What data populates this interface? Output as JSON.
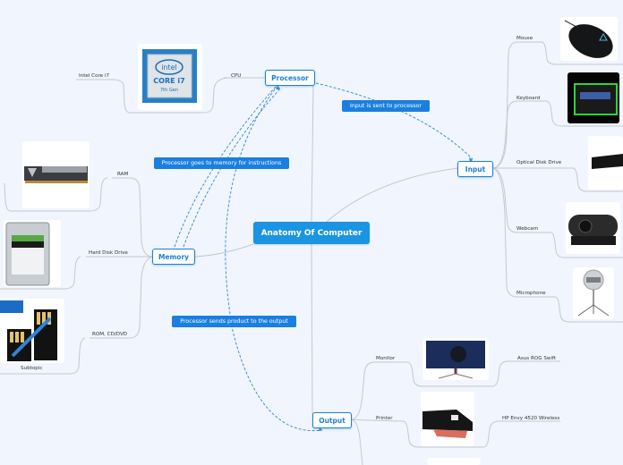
{
  "central": {
    "label": "Anatomy Of Computer"
  },
  "branches": {
    "processor": {
      "label": "Processor",
      "subtopics": [
        {
          "label": "CPU",
          "children": [
            {
              "label": "Intel Core i7"
            }
          ]
        }
      ],
      "images": [
        "intel-core-i7-7th-gen"
      ]
    },
    "memory": {
      "label": "Memory",
      "subtopics": [
        {
          "label": "RAM"
        },
        {
          "label": "Hard Disk Drive"
        },
        {
          "label": "ROM, CD/DVD",
          "children": [
            {
              "label": "Subtopic"
            }
          ]
        }
      ],
      "images": [
        "ram-stick",
        "hard-disk-drive",
        "usb-flash-chips"
      ]
    },
    "input": {
      "label": "Input",
      "subtopics": [
        {
          "label": "Mouse"
        },
        {
          "label": "Keyboard"
        },
        {
          "label": "Optical Disk Drive"
        },
        {
          "label": "Webcam"
        },
        {
          "label": "Microphone"
        }
      ],
      "images": [
        "gaming-mouse",
        "rgb-keyboard",
        "optical-drive",
        "webcam",
        "usb-microphone"
      ]
    },
    "output": {
      "label": "Output",
      "subtopics": [
        {
          "label": "Monitor",
          "children": [
            {
              "label": "Asus ROG Swift"
            }
          ]
        },
        {
          "label": "Printer",
          "children": [
            {
              "label": "HP Envy 4520 Wireless"
            }
          ]
        }
      ],
      "images": [
        "gaming-monitor",
        "inkjet-printer",
        "speaker"
      ]
    }
  },
  "relationships": [
    {
      "from": "Processor",
      "to": "Memory",
      "label": "Processor goes to memory for instructions"
    },
    {
      "from": "Input",
      "to": "Processor",
      "label": "Input is sent to processor"
    },
    {
      "from": "Processor",
      "to": "Output",
      "label": "Processor sends product to the output"
    }
  ],
  "colors": {
    "background": "#f1f5fd",
    "accent": "#1b95e2",
    "node_border": "#1e7fd6",
    "relationship": "#1a7fe0",
    "line": "#b8bec8"
  }
}
